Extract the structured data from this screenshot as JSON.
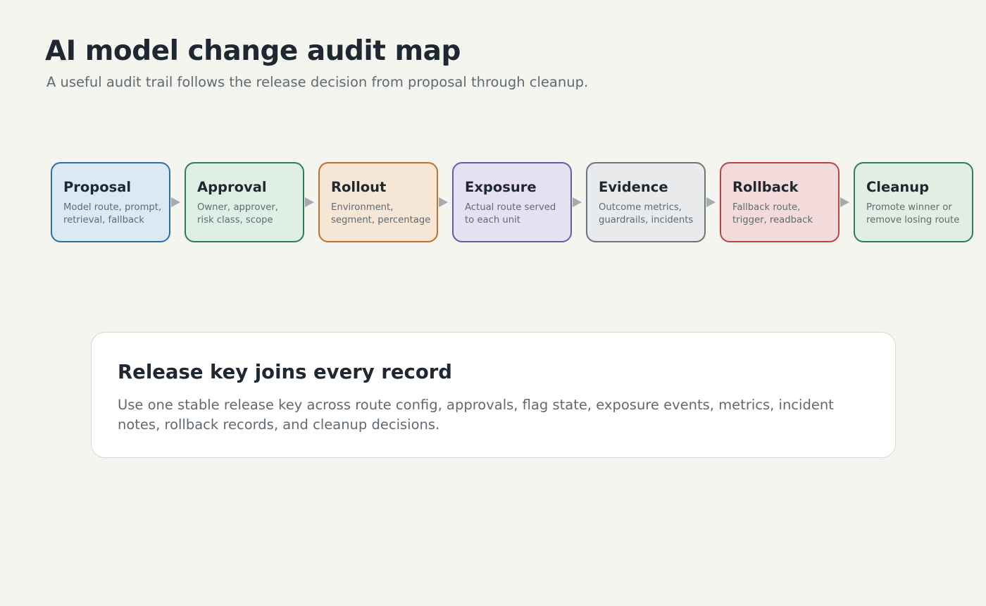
{
  "header": {
    "title": "AI model change audit map",
    "subtitle": "A useful audit trail follows the release decision from proposal through cleanup."
  },
  "arrow_color": "#a2abb3",
  "steps": [
    {
      "title": "Proposal",
      "description": "Model route, prompt, retrieval, fallback",
      "border": "#2f6ea4",
      "fill": "#dbe9f4"
    },
    {
      "title": "Approval",
      "description": "Owner, approver, risk class, scope",
      "border": "#2e7d5a",
      "fill": "#dfefe6"
    },
    {
      "title": "Rollout",
      "description": "Environment, segment, percentage",
      "border": "#c26f2c",
      "fill": "#f6e6d5"
    },
    {
      "title": "Exposure",
      "description": "Actual route served to each unit",
      "border": "#6a5aa6",
      "fill": "#e6e1f1"
    },
    {
      "title": "Evidence",
      "description": "Outcome metrics, guardrails, incidents",
      "border": "#6b7580",
      "fill": "#e8eaec"
    },
    {
      "title": "Rollback",
      "description": "Fallback route, trigger, readback",
      "border": "#b8444a",
      "fill": "#f3dadb"
    },
    {
      "title": "Cleanup",
      "description": "Promote winner or remove losing route",
      "border": "#2e7d5a",
      "fill": "#e1eee4"
    }
  ],
  "release_key": {
    "title": "Release key joins every record",
    "text": "Use one stable release key across route config, approvals, flag state, exposure events, metrics, incident notes, rollback records, and cleanup decisions."
  }
}
